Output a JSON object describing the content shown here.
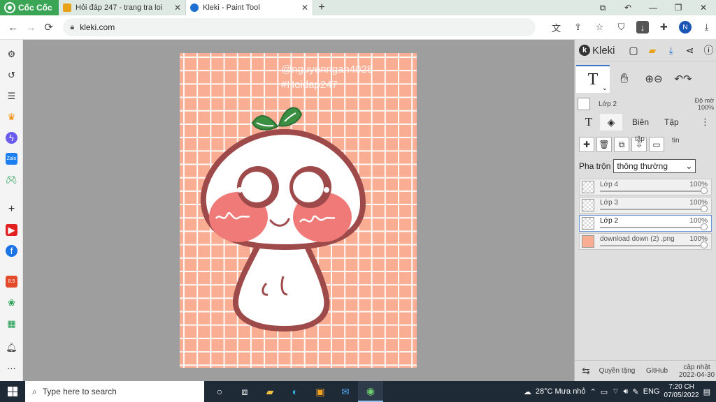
{
  "browser": {
    "brand": "Cốc Cốc",
    "tabs": [
      {
        "title": "Hỏi đáp 247 - trang tra loi",
        "favicon_color": "#e8a21a"
      },
      {
        "title": "Kleki - Paint Tool",
        "favicon_color": "#1f6fd1"
      }
    ],
    "new_tab": "+",
    "url": "kleki.com",
    "profile_initial": "N"
  },
  "canvas": {
    "watermark_user": "@nguyenngan4028",
    "watermark_tag": "#Hoidap247",
    "background_color": "#f9ad92"
  },
  "kleki": {
    "logo_text": "Kleki",
    "tool_letter": "T",
    "current_layer": "Lớp 2",
    "opacity_label": "Độ mờ",
    "opacity_value": "100%",
    "tab_letter": "T",
    "tab_edge": "Biên",
    "tab_file": "Tập",
    "label_tap": "tập",
    "label_tin": "tin",
    "blend_label": "Pha trộn",
    "blend_value": "thông thường",
    "layers": [
      {
        "name": "Lớp 4",
        "opacity": "100%",
        "selected": false
      },
      {
        "name": "Lớp 3",
        "opacity": "100%",
        "selected": false
      },
      {
        "name": "Lớp 2",
        "opacity": "100%",
        "selected": true
      },
      {
        "name": "download down (2) .png",
        "opacity": "100%",
        "selected": false
      }
    ],
    "footer": {
      "privacy": "Quyền tặng",
      "github": "GitHub",
      "updated_label": "cập nhật",
      "updated_date": "2022-04-30"
    }
  },
  "taskbar": {
    "search_placeholder": "Type here to search",
    "weather": "28°C  Mưa nhỏ",
    "lang": "ENG",
    "time": "7:20 CH",
    "date": "07/05/2022"
  }
}
